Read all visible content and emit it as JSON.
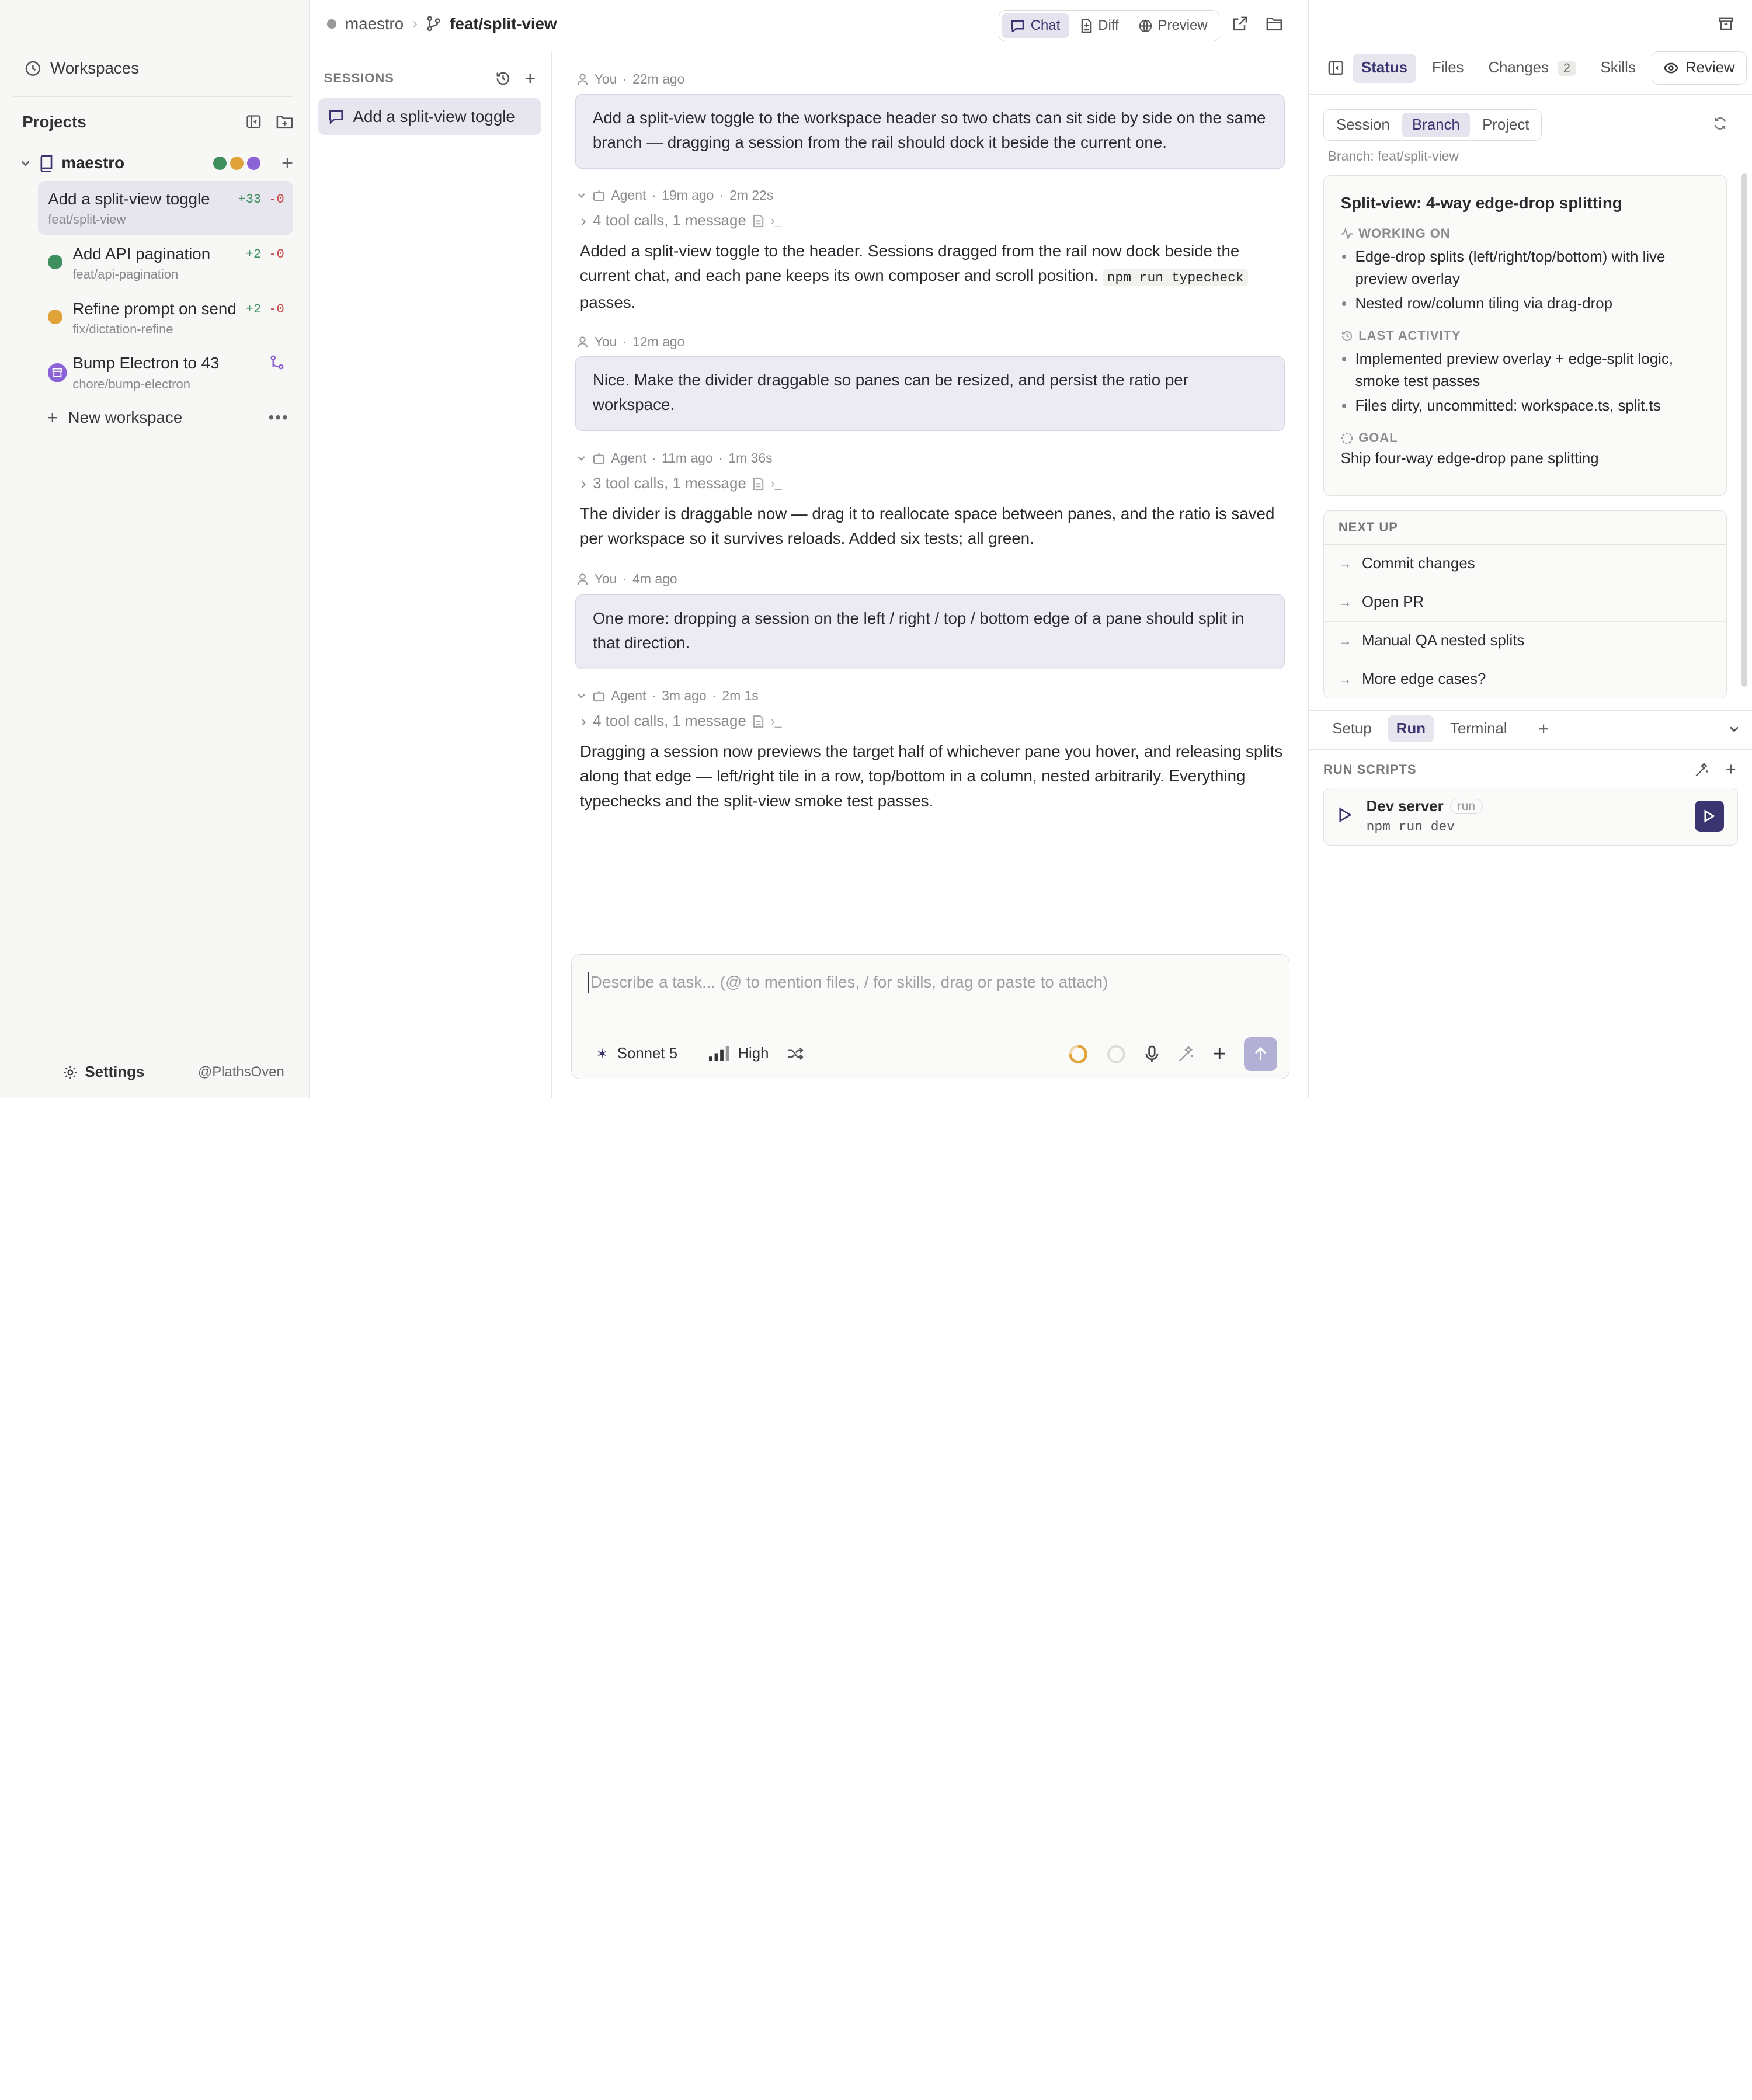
{
  "sidebar": {
    "workspaces_label": "Workspaces",
    "projects_label": "Projects",
    "project": {
      "name": "maestro",
      "status_colors": [
        "#3e8e5e",
        "#e0a33a",
        "#8b63d6"
      ]
    },
    "items": [
      {
        "title": "Add a split-view toggle",
        "branch": "feat/split-view",
        "added": "+33",
        "removed": "-0",
        "status_color": ""
      },
      {
        "title": "Add API pagination",
        "branch": "feat/api-pagination",
        "added": "+2",
        "removed": "-0",
        "status_color": "#3e8e5e"
      },
      {
        "title": "Refine prompt on send",
        "branch": "fix/dictation-refine",
        "added": "+2",
        "removed": "-0",
        "status_color": "#e0a33a"
      },
      {
        "title": "Bump Electron to 43",
        "branch": "chore/bump-electron",
        "added": "",
        "removed": "",
        "status_color": "#8b63d6"
      }
    ],
    "new_workspace_label": "New workspace",
    "settings_label": "Settings",
    "user_handle": "@PlathsOven"
  },
  "topbar": {
    "repo": "maestro",
    "branch": "feat/split-view",
    "view_tabs": [
      "Chat",
      "Diff",
      "Preview"
    ],
    "active_view": "Chat"
  },
  "sessions": {
    "label": "SESSIONS",
    "items": [
      {
        "title": "Add a split-view toggle"
      }
    ]
  },
  "chat": {
    "messages": [
      {
        "role": "You",
        "time": "22m ago",
        "text": "Add a split-view toggle to the workspace header so two chats can sit side by side on the same branch — dragging a session from the rail should dock it beside the current one."
      },
      {
        "role": "Agent",
        "time": "19m ago",
        "duration": "2m 22s",
        "tools": "4 tool calls, 1 message",
        "text_before": "Added a split-view toggle to the header. Sessions dragged from the rail now dock beside the current chat, and each pane keeps its own composer and scroll position. ",
        "code": "npm run typecheck",
        "text_after": " passes."
      },
      {
        "role": "You",
        "time": "12m ago",
        "text": "Nice. Make the divider draggable so panes can be resized, and persist the ratio per workspace."
      },
      {
        "role": "Agent",
        "time": "11m ago",
        "duration": "1m 36s",
        "tools": "3 tool calls, 1 message",
        "text": "The divider is draggable now — drag it to reallocate space between panes, and the ratio is saved per workspace so it survives reloads. Added six tests; all green."
      },
      {
        "role": "You",
        "time": "4m ago",
        "text": "One more: dropping a session on the left / right / top / bottom edge of a pane should split in that direction."
      },
      {
        "role": "Agent",
        "time": "3m ago",
        "duration": "2m 1s",
        "tools": "4 tool calls, 1 message",
        "text": "Dragging a session now previews the target half of whichever pane you hover, and releasing splits along that edge — left/right tile in a row, top/bottom in a column, nested arbitrarily. Everything typechecks and the split-view smoke test passes."
      }
    ],
    "composer": {
      "placeholder": "Describe a task... (@ to mention files, / for skills, drag or paste to attach)",
      "model": "Sonnet 5",
      "effort": "High"
    }
  },
  "right_panel": {
    "tabs": [
      {
        "label": "Status"
      },
      {
        "label": "Files"
      },
      {
        "label": "Changes",
        "badge": "2"
      },
      {
        "label": "Skills"
      }
    ],
    "active_tab": "Status",
    "review_label": "Review",
    "scopes": [
      "Session",
      "Branch",
      "Project"
    ],
    "active_scope": "Branch",
    "branch_line": "Branch: feat/split-view",
    "status_card": {
      "title": "Split-view: 4-way edge-drop splitting",
      "working_on_label": "WORKING ON",
      "working_on": [
        "Edge-drop splits (left/right/top/bottom) with live preview overlay",
        "Nested row/column tiling via drag-drop"
      ],
      "last_activity_label": "LAST ACTIVITY",
      "last_activity": [
        "Implemented preview overlay + edge-split logic, smoke test passes",
        "Files dirty, uncommitted: workspace.ts, split.ts"
      ],
      "goal_label": "GOAL",
      "goal": "Ship four-way edge-drop pane splitting"
    },
    "next_up": {
      "label": "NEXT UP",
      "items": [
        "Commit changes",
        "Open PR",
        "Manual QA nested splits",
        "More edge cases?"
      ]
    },
    "bottom_tabs": [
      "Setup",
      "Run",
      "Terminal"
    ],
    "active_bottom_tab": "Run",
    "run_scripts": {
      "label": "RUN SCRIPTS",
      "scripts": [
        {
          "name": "Dev server",
          "tag": "run",
          "command": "npm run dev"
        }
      ]
    }
  },
  "colors": {
    "accent": "#3a3470",
    "accent_soft": "#e7e6ef",
    "added": "#3e8e5e",
    "removed": "#c94a4a"
  }
}
